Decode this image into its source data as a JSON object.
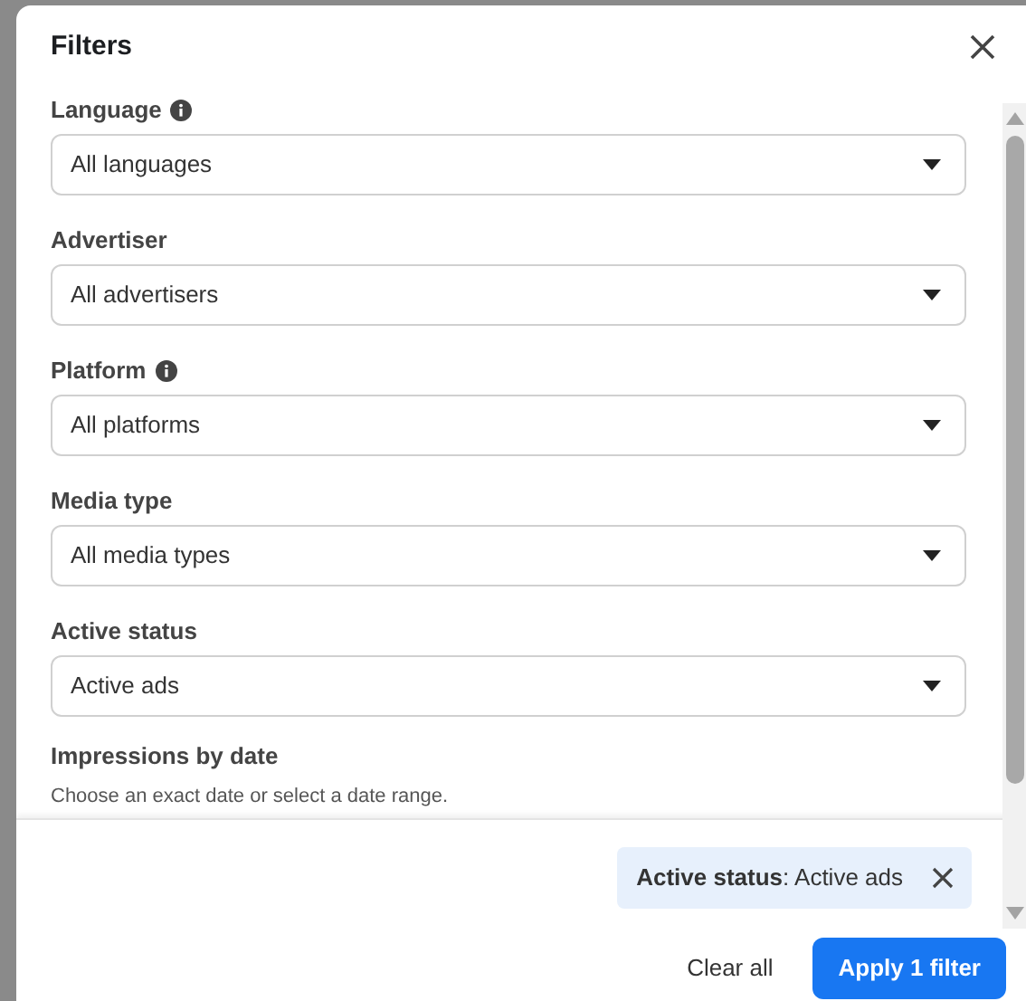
{
  "dialog": {
    "title": "Filters"
  },
  "fields": [
    {
      "label": "Language",
      "info": true,
      "value": "All languages"
    },
    {
      "label": "Advertiser",
      "info": false,
      "value": "All advertisers"
    },
    {
      "label": "Platform",
      "info": true,
      "value": "All platforms"
    },
    {
      "label": "Media type",
      "info": false,
      "value": "All media types"
    },
    {
      "label": "Active status",
      "info": false,
      "value": "Active ads"
    }
  ],
  "date_section": {
    "label": "Impressions by date",
    "hint": "Choose an exact date or select a date range."
  },
  "active_filter_chip": {
    "name": "Active status",
    "value": ": Active ads"
  },
  "buttons": {
    "clear": "Clear all",
    "apply": "Apply 1 filter"
  }
}
